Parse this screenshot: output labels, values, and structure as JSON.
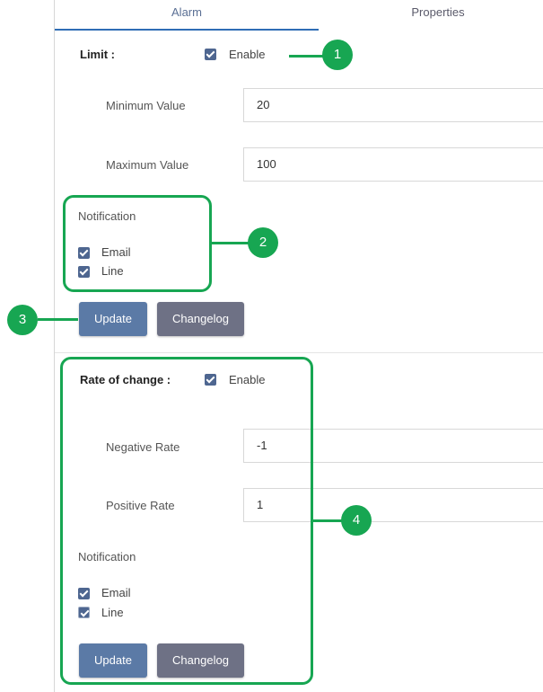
{
  "tabs": {
    "alarm": "Alarm",
    "properties": "Properties"
  },
  "limit": {
    "title": "Limit :",
    "enable_label": "Enable",
    "min_label": "Minimum Value",
    "min_value": "20",
    "max_label": "Maximum Value",
    "max_value": "100",
    "notification_title": "Notification",
    "email_label": "Email",
    "line_label": "Line",
    "update_label": "Update",
    "changelog_label": "Changelog"
  },
  "rate": {
    "title": "Rate of change :",
    "enable_label": "Enable",
    "negative_label": "Negative Rate",
    "negative_value": "-1",
    "positive_label": "Positive Rate",
    "positive_value": "1",
    "notification_title": "Notification",
    "email_label": "Email",
    "line_label": "Line",
    "update_label": "Update",
    "changelog_label": "Changelog"
  },
  "annotations": [
    "1",
    "2",
    "3",
    "4"
  ],
  "colors": {
    "accent_green": "#17a652",
    "checkbox": "#4e6690",
    "update_button": "#5b7aa6",
    "changelog_button": "#6e7185"
  }
}
